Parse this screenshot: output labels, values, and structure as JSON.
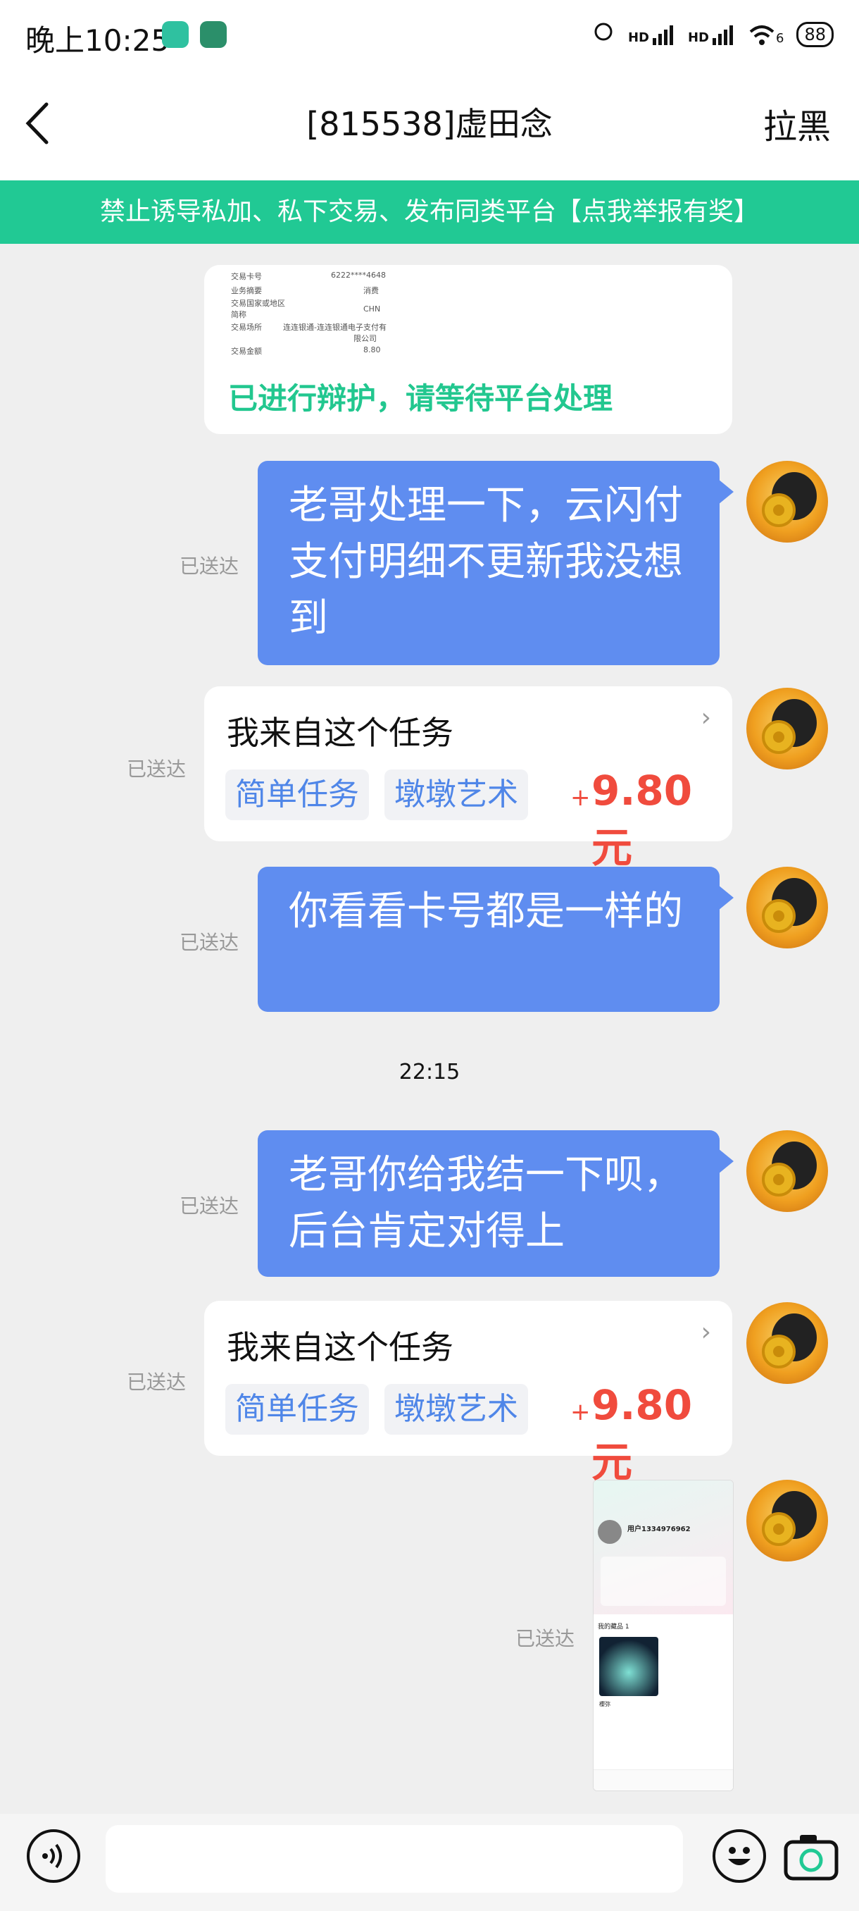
{
  "status_bar": {
    "time": "晚上10:25",
    "signal_1": "HD",
    "signal_2": "HD",
    "wifi_sub": "6",
    "battery": "88"
  },
  "nav": {
    "title": "[815538]虚田念",
    "block_label": "拉黑"
  },
  "banner": {
    "text": "禁止诱导私加、私下交易、发布同类平台【点我举报有奖】"
  },
  "receipt": {
    "rows": [
      {
        "label": "交易卡号",
        "value": "6222****4648"
      },
      {
        "label": "业务摘要",
        "value": "消费"
      },
      {
        "label": "交易国家或地区",
        "value": "CHN"
      },
      {
        "label": "简称",
        "value": ""
      },
      {
        "label": "交易场所",
        "value": "连连银通-连连银通电子支付有"
      },
      {
        "label": "",
        "value": "限公司"
      },
      {
        "label": "交易金额",
        "value": "8.80"
      }
    ],
    "note": "已进行辩护，请等待平台处理"
  },
  "messages": {
    "msg1": {
      "text": "老哥处理一下，云闪付支付明细不更新我没想到",
      "status": "已送达"
    },
    "task1": {
      "title": "我来自这个任务",
      "tag1": "简单任务",
      "tag2": "墩墩艺术",
      "plus": "+",
      "price": "9.80元",
      "status": "已送达"
    },
    "msg2": {
      "text": "你看看卡号都是一样的",
      "status": "已送达"
    },
    "timestamp": "22:15",
    "msg3": {
      "text": "老哥你给我结一下呗，后台肯定对得上",
      "status": "已送达"
    },
    "task2": {
      "title": "我来自这个任务",
      "tag1": "简单任务",
      "tag2": "墩墩艺术",
      "plus": "+",
      "price": "9.80元",
      "status": "已送达"
    },
    "image_msg": {
      "status": "已送达"
    }
  },
  "screenshot_thumb": {
    "username": "用户1334976962",
    "section": "我的藏品 1",
    "item_name": "櫻弥"
  },
  "input": {
    "placeholder": ""
  },
  "colors": {
    "banner": "#21c994",
    "bubble": "#5f8df0",
    "price": "#f04b3d",
    "tag_text": "#4f86e8",
    "note": "#22c78f"
  }
}
